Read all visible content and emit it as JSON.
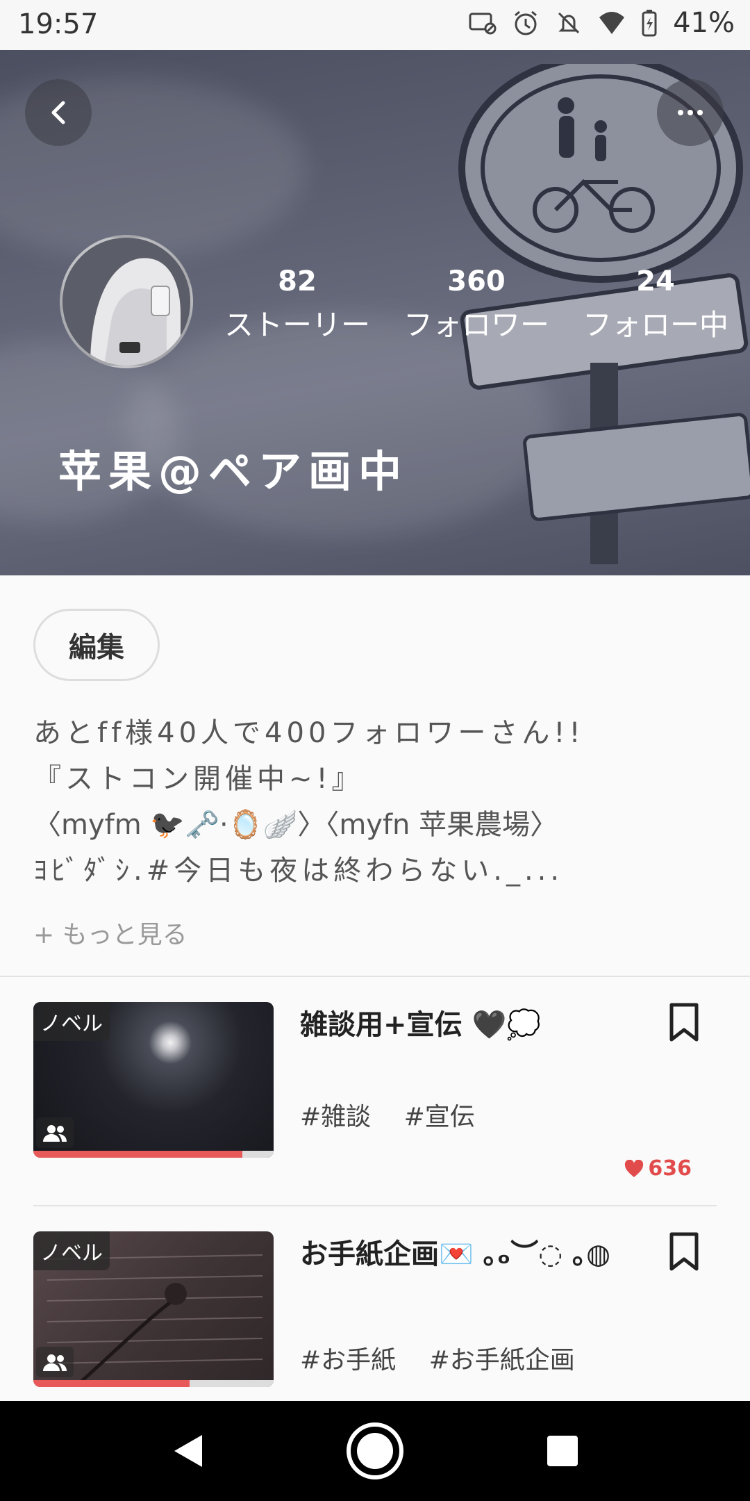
{
  "status_bar": {
    "time": "19:57",
    "battery": "41%",
    "icons": [
      "cast-icon",
      "alarm-icon",
      "notifications-off-icon",
      "wifi-icon",
      "battery-icon"
    ]
  },
  "profile": {
    "username": "苹果@ペア画中",
    "stats": [
      {
        "value": "82",
        "label": "ストーリー"
      },
      {
        "value": "360",
        "label": "フォロワー"
      },
      {
        "value": "24",
        "label": "フォロー中"
      }
    ],
    "edit_label": "編集",
    "bio_lines": [
      "あとff様40人で400フォロワーさん!!",
      "『ストコン開催中~!』",
      "〈myfm 🐦‍⬛🗝️·🪞🪽〉〈myfn 苹果農場〉",
      "ﾖﾋﾞﾀﾞｼ.#今日も夜は終わらない._..."
    ],
    "more_label": "+ もっと見る"
  },
  "stories": [
    {
      "type_tag": "ノベル",
      "title": "雑談用+宣伝 🖤💭",
      "tags": [
        "#雑談",
        "#宣伝"
      ],
      "likes": "636",
      "progress": 0.87
    },
    {
      "type_tag": "ノベル",
      "title": "お手紙企画💌 ｡ₒ︶◌ ｡◍",
      "tags": [
        "#お手紙",
        "#お手紙企画"
      ],
      "likes": "",
      "progress": 0.65
    }
  ],
  "colors": {
    "accent": "#e85a5a",
    "like": "#e24b4b"
  }
}
